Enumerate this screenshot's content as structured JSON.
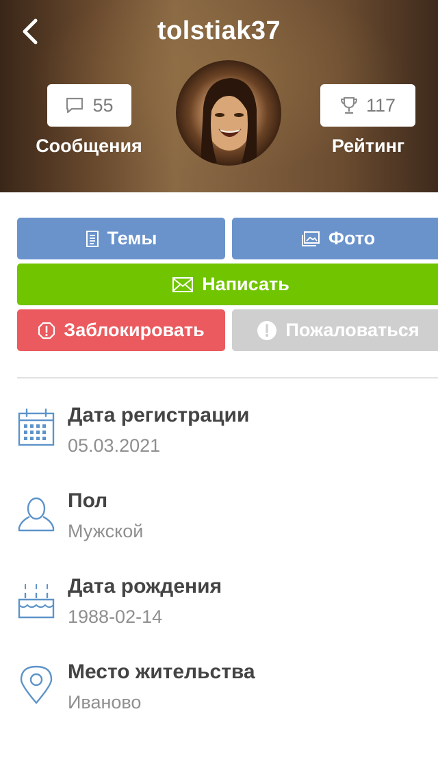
{
  "header": {
    "username": "tolstiak37",
    "messages": {
      "count": "55",
      "label": "Сообщения",
      "icon": "speech-bubble-icon"
    },
    "rating": {
      "count": "117",
      "label": "Рейтинг",
      "icon": "trophy-icon"
    }
  },
  "actions": {
    "topics_label": "Темы",
    "photo_label": "Фото",
    "write_label": "Написать",
    "block_label": "Заблокировать",
    "report_label": "Пожаловаться"
  },
  "colors": {
    "accent_blue": "#6a93cc",
    "write_green": "#71c400",
    "block_red": "#ea5a5e",
    "report_gray": "#cfcfcf",
    "icon_blue": "#5d93c9"
  },
  "info": [
    {
      "icon": "calendar-icon",
      "title": "Дата регистрации",
      "value": "05.03.2021"
    },
    {
      "icon": "user-icon",
      "title": "Пол",
      "value": "Мужской"
    },
    {
      "icon": "birthday-cake-icon",
      "title": "Дата рождения",
      "value": "1988-02-14"
    },
    {
      "icon": "location-pin-icon",
      "title": "Место жительства",
      "value": "Иваново"
    }
  ]
}
